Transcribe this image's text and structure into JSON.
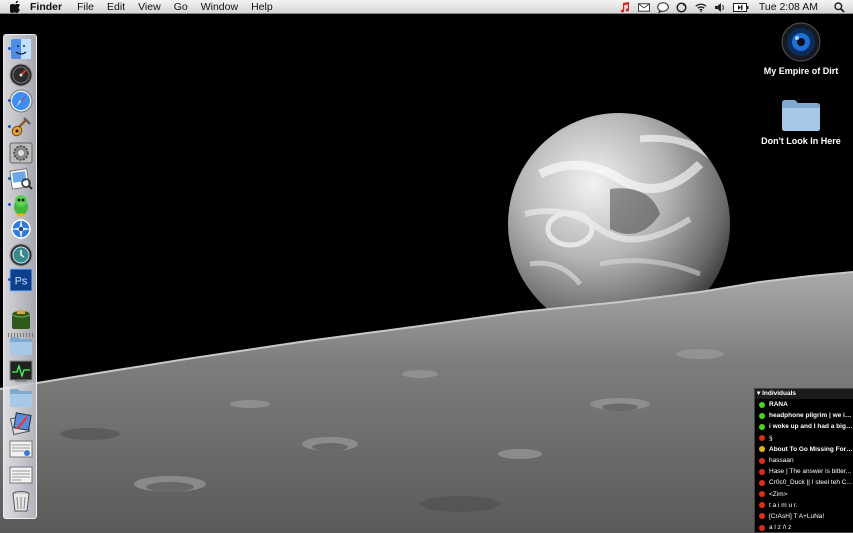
{
  "menubar": {
    "app_name": "Finder",
    "menus": [
      "File",
      "Edit",
      "View",
      "Go",
      "Window",
      "Help"
    ],
    "clock": "Tue 2:08 AM",
    "status_icons": [
      "itunes-note-icon",
      "mail-icon",
      "chat-bubble-icon",
      "sync-icon",
      "wifi-icon",
      "speaker-icon",
      "battery-icon",
      "spotlight-icon"
    ],
    "status_colors": {
      "itunes": "#d62020"
    }
  },
  "dock": {
    "items": [
      {
        "name": "finder-icon",
        "running": true
      },
      {
        "name": "dashboard-icon",
        "running": false
      },
      {
        "name": "safari-icon",
        "running": true
      },
      {
        "name": "garageband-icon",
        "running": true
      },
      {
        "name": "system-preferences-icon",
        "running": false
      },
      {
        "name": "preview-icon",
        "running": true
      },
      {
        "name": "adium-icon",
        "running": true
      },
      {
        "name": "compass-icon",
        "running": false
      },
      {
        "name": "time-machine-icon",
        "running": false
      },
      {
        "name": "photoshop-icon",
        "running": true
      },
      {
        "name": "wallet-icon",
        "running": false
      },
      {
        "name": "folder-icon",
        "running": false
      },
      {
        "name": "activity-monitor-icon",
        "running": false
      },
      {
        "name": "folder-icon",
        "running": false
      },
      {
        "name": "applications-stack-icon",
        "running": false
      },
      {
        "name": "document-stack-icon",
        "running": false
      },
      {
        "name": "document-stack-icon",
        "running": false
      },
      {
        "name": "trash-icon",
        "running": false
      }
    ],
    "photoshop_label": "Ps"
  },
  "desktop_icons": [
    {
      "label": "My Empire of Dirt",
      "icon": "speaker-disk-icon"
    },
    {
      "label": "Don't Look In Here",
      "icon": "folder-icon"
    }
  ],
  "buddy_list": {
    "group": "Individuals",
    "status_colors": {
      "available": "#4fd21e",
      "away": "#e02c1a",
      "idle": "#e3b51d"
    },
    "buddies": [
      {
        "name": "RANA",
        "status": "available",
        "bold": true
      },
      {
        "name": "headphone pilgrim | we ig...",
        "status": "available",
        "bold": true
      },
      {
        "name": "i woke up and I had a big i...",
        "status": "available",
        "bold": true
      },
      {
        "name": "§",
        "status": "away",
        "bold": false
      },
      {
        "name": "About To Go Missing For A...",
        "status": "idle",
        "bold": true
      },
      {
        "name": "hassaan",
        "status": "away",
        "bold": false
      },
      {
        "name": "Hase | The answer is bitter...",
        "status": "away",
        "bold": false
      },
      {
        "name": "Cr0c0_Duck || I steel teh C...",
        "status": "away",
        "bold": false
      },
      {
        "name": "<Zim>",
        "status": "away",
        "bold": false
      },
      {
        "name": "t a i m u r.",
        "status": "away",
        "bold": false
      },
      {
        "name": "[CrAsH] T A+LuNa!",
        "status": "away",
        "bold": false
      },
      {
        "name": "a l z /\\ z",
        "status": "away",
        "bold": false
      }
    ]
  }
}
